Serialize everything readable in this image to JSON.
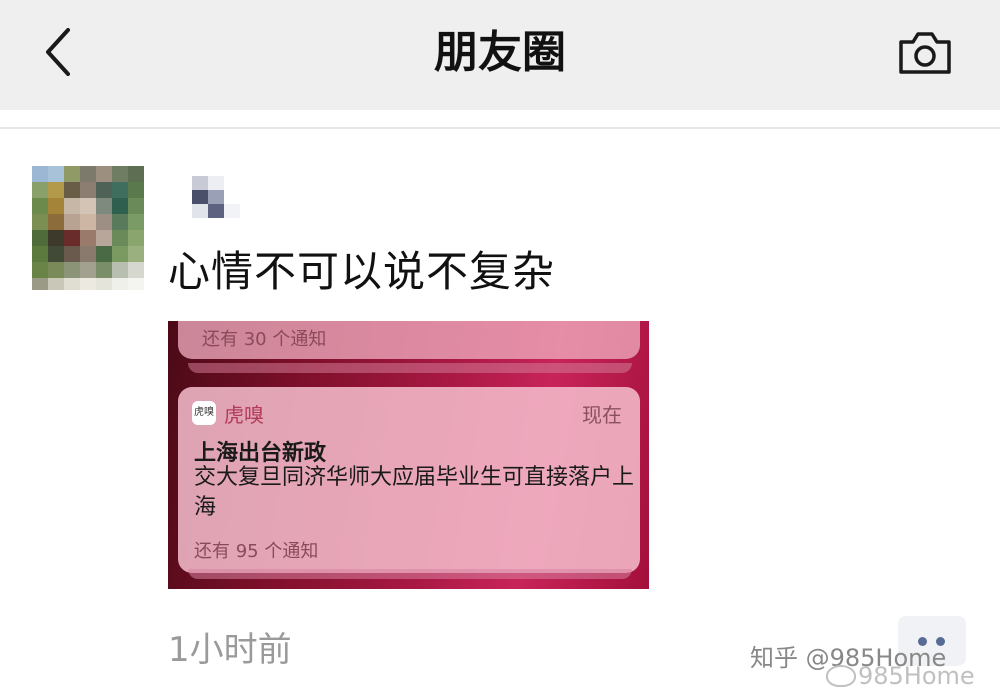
{
  "navbar": {
    "title": "朋友圈",
    "back_icon": "chevron-left-icon",
    "camera_icon": "camera-icon"
  },
  "post": {
    "text": "心情不可以说不复杂",
    "time": "1小时前",
    "image": {
      "top_card_more": "还有 30 个通知",
      "notification": {
        "app_icon_text": "虎嗅",
        "app_name": "虎嗅",
        "time": "现在",
        "title": "上海出台新政",
        "body": "交大复旦同济华师大应届毕业生可直接落户上海",
        "more": "还有 95 个通知"
      }
    }
  },
  "watermarks": {
    "zhihu": "知乎 @985Home",
    "weibo": "985Home"
  },
  "colors": {
    "nav_bg": "#efefef",
    "link_blue": "#576b95",
    "time_gray": "#9a9a9a",
    "accent_red": "#b33a5a"
  }
}
